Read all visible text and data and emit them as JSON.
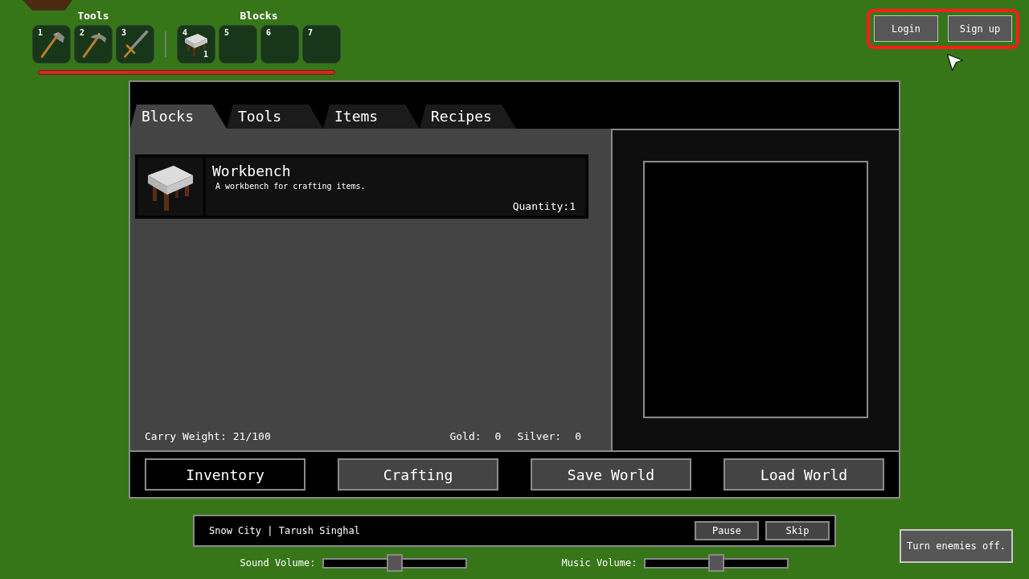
{
  "hotbar": {
    "groups": [
      {
        "label": "Tools",
        "slots": [
          {
            "number": "1",
            "kind": "axe"
          },
          {
            "number": "2",
            "kind": "pickaxe"
          },
          {
            "number": "3",
            "kind": "sword"
          }
        ]
      },
      {
        "label": "Blocks",
        "slots": [
          {
            "number": "4",
            "kind": "workbench",
            "count": "1"
          },
          {
            "number": "5",
            "kind": "empty"
          },
          {
            "number": "6",
            "kind": "empty"
          },
          {
            "number": "7",
            "kind": "empty"
          }
        ]
      }
    ]
  },
  "auth": {
    "highlighted": true,
    "buttons": [
      "Login",
      "Sign up"
    ]
  },
  "panel": {
    "tabs": [
      {
        "label": "Blocks",
        "selected": true
      },
      {
        "label": "Tools",
        "selected": false
      },
      {
        "label": "Items",
        "selected": false
      },
      {
        "label": "Recipes",
        "selected": false
      }
    ],
    "items": [
      {
        "kind": "workbench",
        "name": "Workbench",
        "description": "A workbench for crafting items.",
        "quantity": "Quantity:1"
      }
    ],
    "carry_weight": {
      "label": "Carry Weight:",
      "value": "21/100"
    },
    "currency": [
      {
        "label": "Gold:",
        "value": "0"
      },
      {
        "label": "Silver:",
        "value": "0"
      }
    ],
    "buttons": [
      {
        "label": "Inventory",
        "selected": true
      },
      {
        "label": "Crafting",
        "selected": false
      },
      {
        "label": "Save World",
        "selected": false
      },
      {
        "label": "Load World",
        "selected": false
      }
    ]
  },
  "music": {
    "track": "Snow City | Tarush Singhal",
    "buttons": [
      "Pause",
      "Skip"
    ]
  },
  "volume": [
    {
      "label": "Sound Volume:",
      "level": 0.5
    },
    {
      "label": "Music Volume:",
      "level": 0.5
    }
  ],
  "enemies_button": "Turn enemies off."
}
